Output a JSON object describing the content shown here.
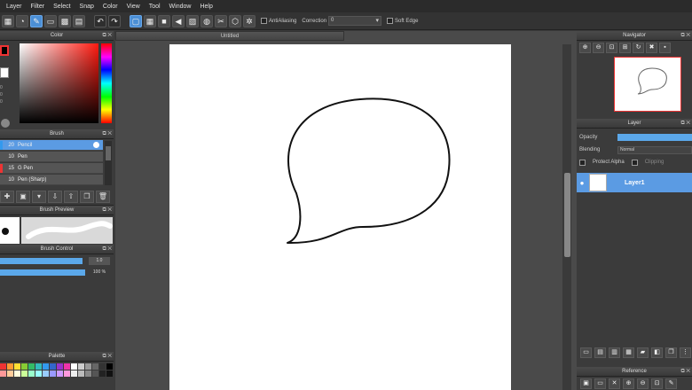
{
  "menu": [
    "Layer",
    "Filter",
    "Select",
    "Snap",
    "Color",
    "View",
    "Tool",
    "Window",
    "Help"
  ],
  "toolbar": {
    "antialiasing_label": "AntiAliasing",
    "correction_label": "Correction",
    "correction_value": "0",
    "soft_edge_label": "Soft Edge"
  },
  "color_panel": {
    "title": "Color",
    "values": [
      "0",
      "0",
      "0"
    ]
  },
  "brush_panel": {
    "title": "Brush",
    "items": [
      {
        "size": "20",
        "name": "Pencil",
        "selected": true
      },
      {
        "size": "10",
        "name": "Pen",
        "selected": false
      },
      {
        "size": "15",
        "name": "G Pen",
        "selected": false
      },
      {
        "size": "10",
        "name": "Pen (Sharp)",
        "selected": false
      }
    ]
  },
  "brush_preview": {
    "title": "Brush Preview"
  },
  "brush_control": {
    "title": "Brush Control",
    "size_value": "1.0",
    "opacity_value": "100 %",
    "size_level": 0.97,
    "opacity_level": 1.0
  },
  "palette": {
    "title": "Palette",
    "colors": [
      "#e33",
      "#f93",
      "#fd3",
      "#8c3",
      "#3b6",
      "#3bb",
      "#39e",
      "#36c",
      "#93c",
      "#e3a",
      "#fff",
      "#ccc",
      "#999",
      "#666",
      "#333",
      "#000",
      "#f99",
      "#fc9",
      "#ffd",
      "#cf9",
      "#9fc",
      "#9ff",
      "#9cf",
      "#99f",
      "#c9f",
      "#f9d",
      "#eee",
      "#bbb",
      "#888",
      "#555",
      "#222",
      "#111"
    ]
  },
  "document": {
    "tab_title": "Untitled"
  },
  "navigator": {
    "title": "Navigator"
  },
  "layer_panel": {
    "title": "Layer",
    "opacity_label": "Opacity",
    "blending_label": "Blending",
    "blending_value": "Normal",
    "protect_alpha_label": "Protect Alpha",
    "clipping_label": "Clipping",
    "layers": [
      {
        "name": "Layer1",
        "visible": true
      }
    ]
  },
  "reference": {
    "title": "Reference"
  }
}
